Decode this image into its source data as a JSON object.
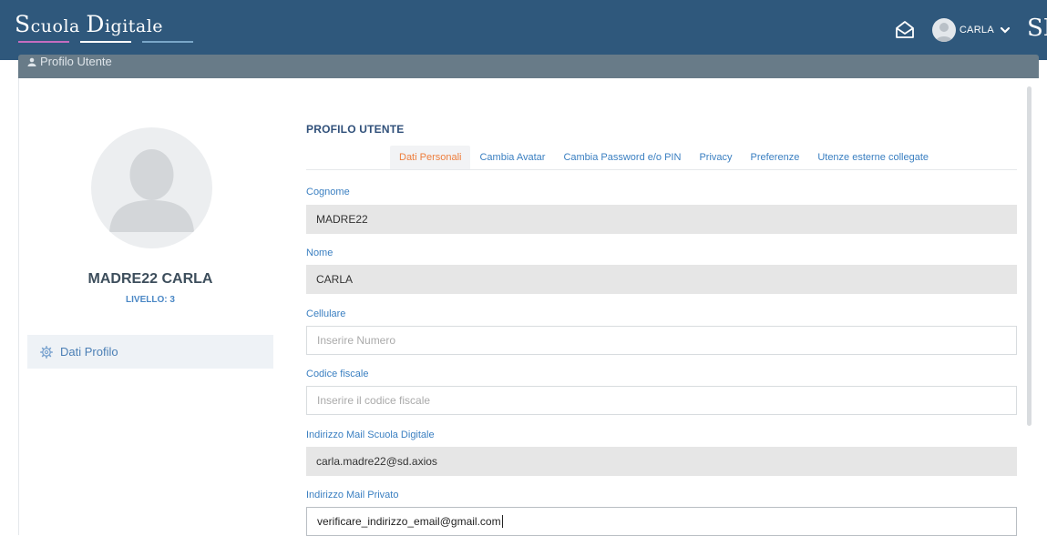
{
  "brand": {
    "first_big": "S",
    "first_small": "cuola ",
    "second_big": "D",
    "second_small": "igitale"
  },
  "nav": {
    "user_label": "CARLA",
    "logo_text": "SD",
    "icons": {
      "mail": "envelope-open-icon",
      "chevron": "chevron-down-icon"
    }
  },
  "panel": {
    "title": "Profilo Utente"
  },
  "profile": {
    "name": "MADRE22 CARLA",
    "level": "LIVELLO: 3",
    "menu_item": "Dati Profilo"
  },
  "main": {
    "section_title": "PROFILO UTENTE",
    "tabs": [
      {
        "label": "Dati Personali",
        "active": true
      },
      {
        "label": "Cambia Avatar"
      },
      {
        "label": "Cambia Password e/o PIN"
      },
      {
        "label": "Privacy"
      },
      {
        "label": "Preferenze"
      },
      {
        "label": "Utenze esterne collegate"
      }
    ],
    "fields": {
      "cognome": {
        "label": "Cognome",
        "value": "MADRE22"
      },
      "nome": {
        "label": "Nome",
        "value": "CARLA"
      },
      "cellulare": {
        "label": "Cellulare",
        "placeholder": "Inserire Numero"
      },
      "codice_fiscale": {
        "label": "Codice fiscale",
        "placeholder": "Inserire il codice fiscale"
      },
      "mail_scuola": {
        "label": "Indirizzo Mail Scuola Digitale",
        "value": "carla.madre22@sd.axios"
      },
      "mail_privato": {
        "label": "Indirizzo Mail Privato",
        "value": "verificare_indirizzo_email@gmail.com"
      }
    }
  },
  "colors": {
    "navbar": "#2f587c",
    "panel_header": "#687b88",
    "accent_blue": "#3a7fc1",
    "active_tab": "#ee7e3d"
  }
}
